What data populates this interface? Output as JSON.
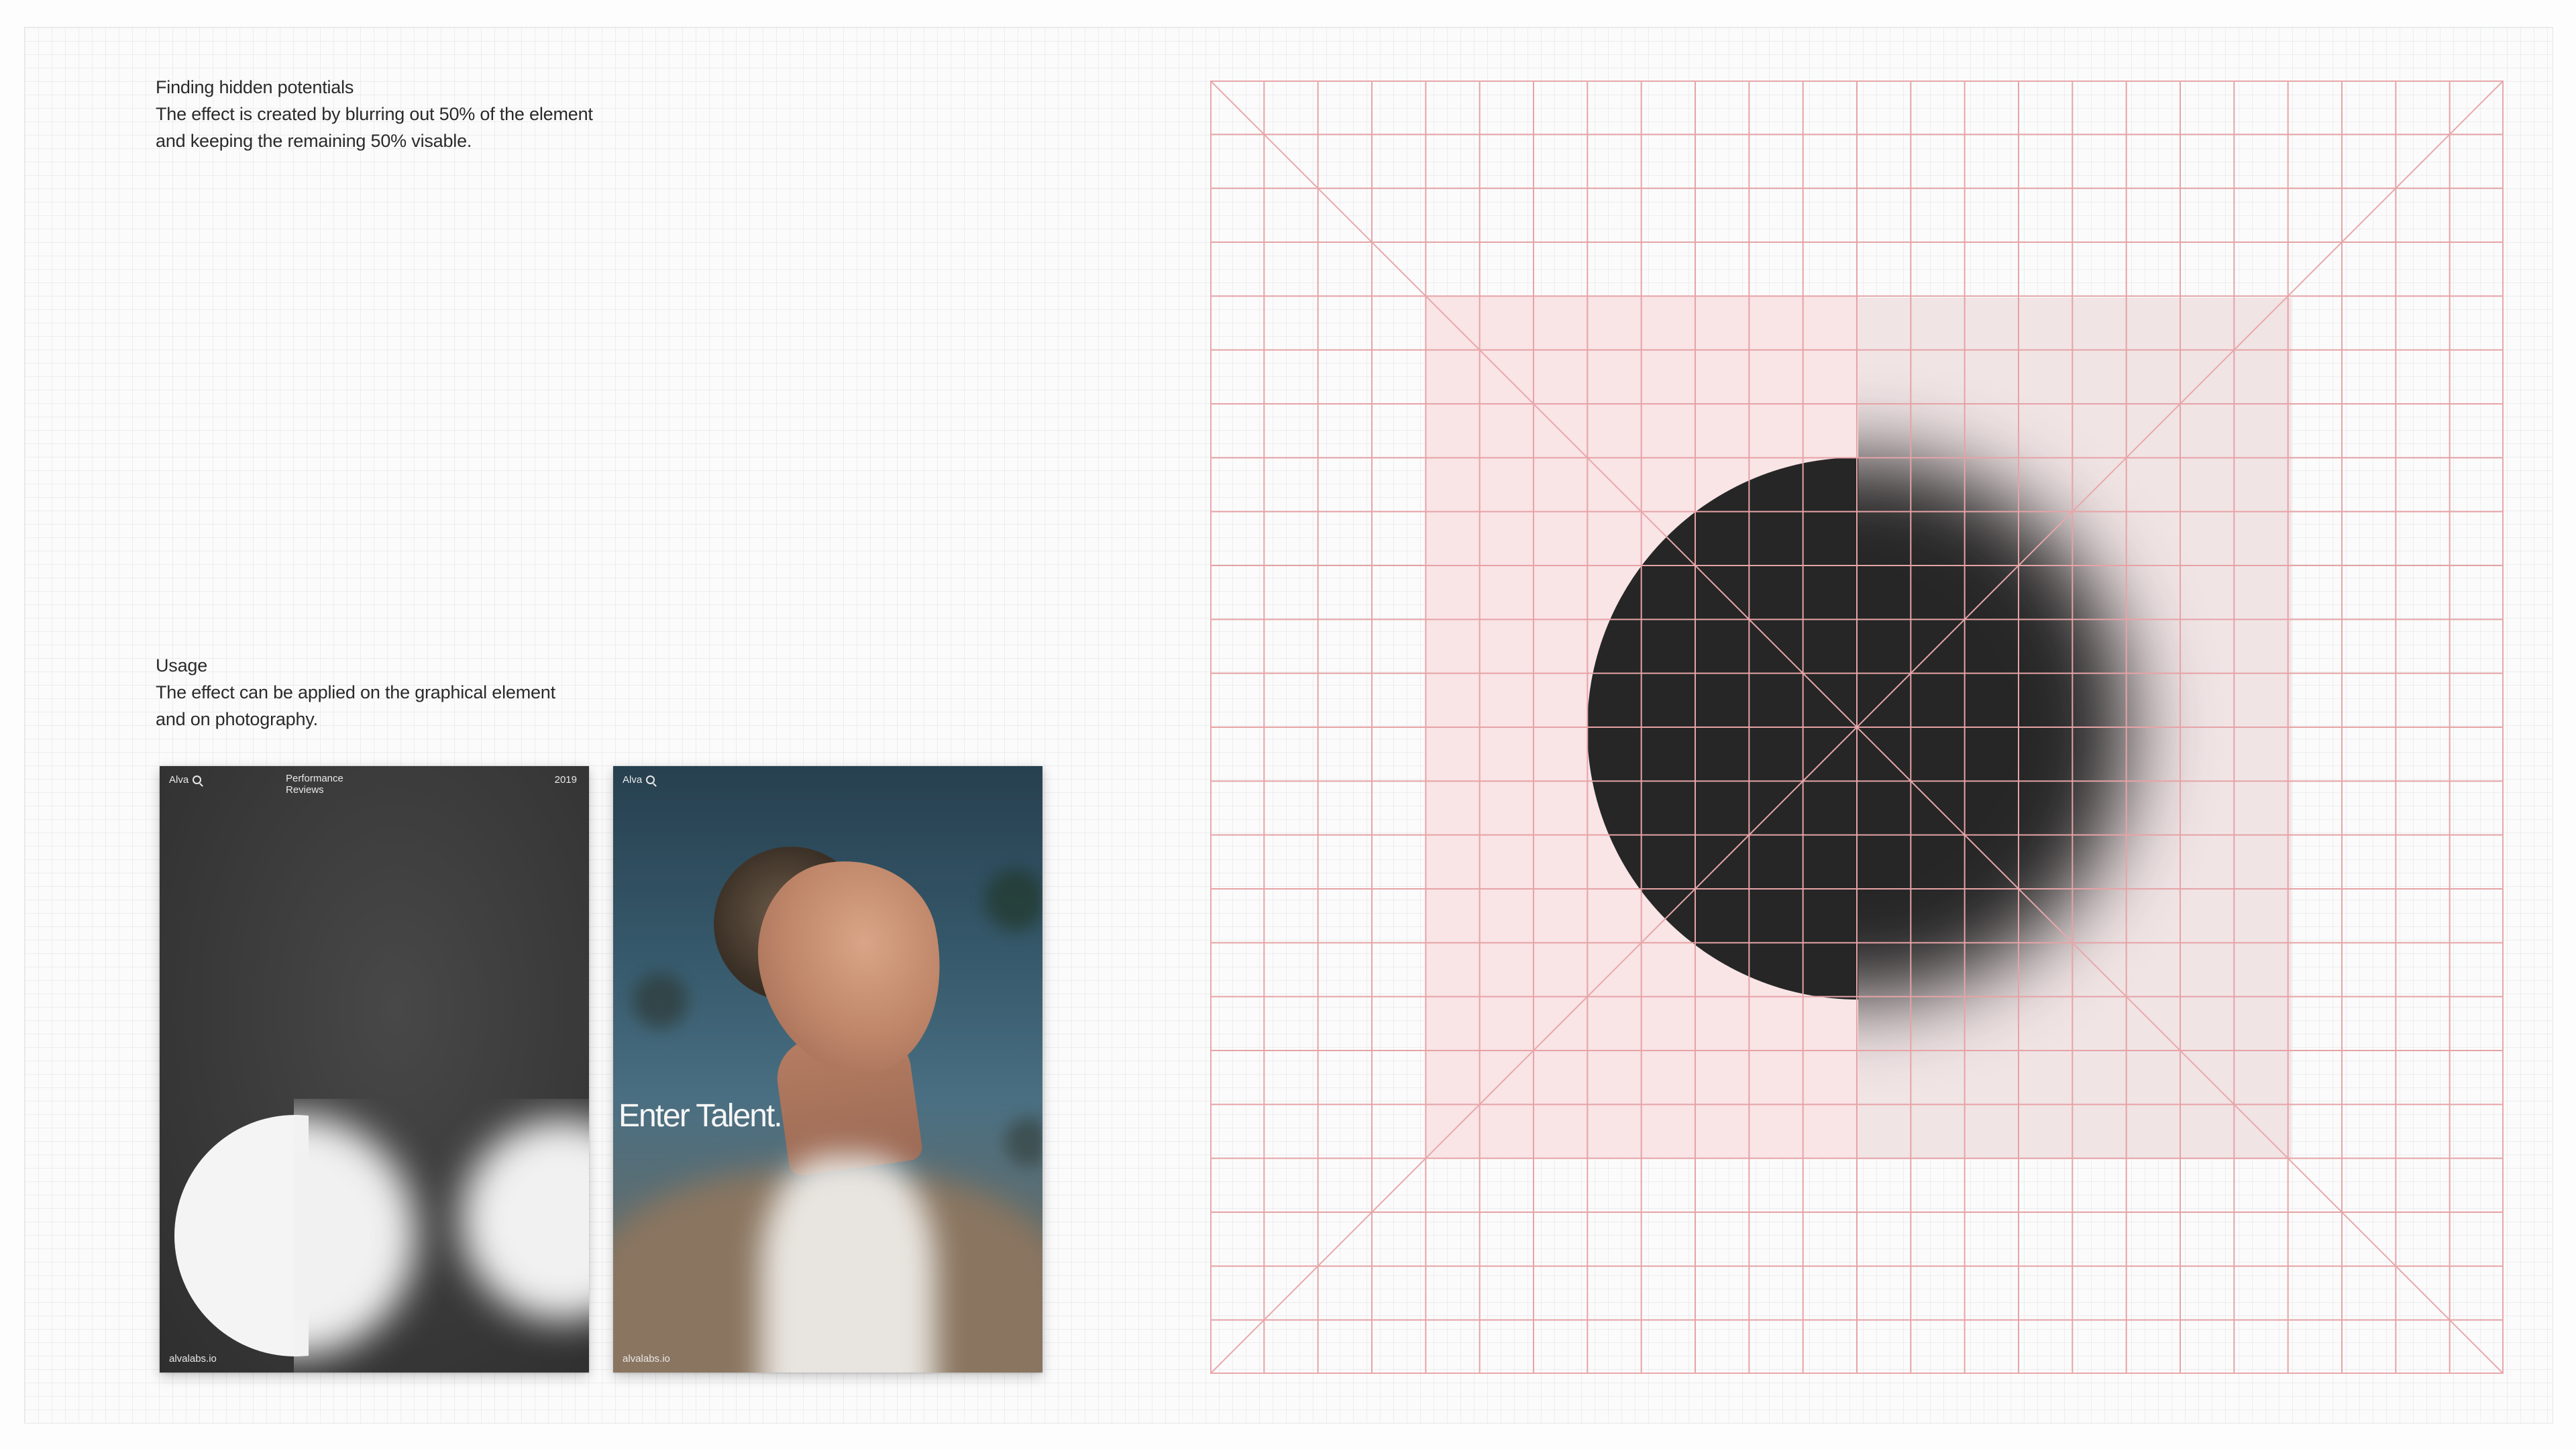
{
  "intro": {
    "title": "Finding hidden potentials",
    "line1": "The effect is created by blurring out 50% of the element",
    "line2": "and keeping the remaining 50% visable."
  },
  "usage": {
    "title": "Usage",
    "line1": "The effect can be applied on the graphical element",
    "line2": "and on photography."
  },
  "poster_1": {
    "brand": "Alva",
    "subtitle_line1": "Performance",
    "subtitle_line2": "Reviews",
    "year": "2019",
    "url": "alvalabs.io"
  },
  "poster_2": {
    "brand": "Alva",
    "headline": "Enter Talent.",
    "url": "alvalabs.io"
  },
  "colors": {
    "grid_line": "#e6a3a6",
    "shaded_area": "#f9e4e6",
    "blur_panel": "#f1e4e5",
    "circle": "#262626"
  }
}
